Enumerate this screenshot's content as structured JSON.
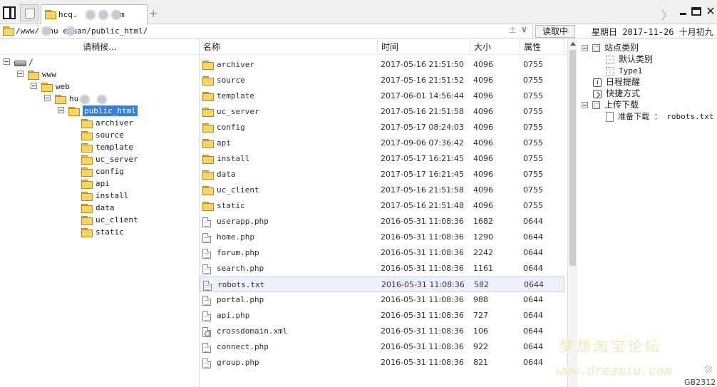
{
  "tabbar": {
    "active_tab_label": "hcq.",
    "active_tab_label_tail": "om",
    "new_tab_symbol": "+",
    "overflow_symbol": "〉"
  },
  "window": {
    "close_symbol": "✕"
  },
  "address": {
    "path": "/www/   /hu    equan/public_html/",
    "plusminus": "±",
    "dropdown": "∨",
    "read_button": "读取中",
    "date_text": "星期日  2017-11-26  十月初九"
  },
  "left_tree": {
    "header": "请稍候...",
    "root_label": "/",
    "www_label": "www",
    "web_label": "web",
    "site_label": "hu          a",
    "current_label": "public_html",
    "children": [
      "archiver",
      "source",
      "template",
      "uc_server",
      "config",
      "api",
      "install",
      "data",
      "uc_client",
      "static"
    ]
  },
  "file_list": {
    "columns": {
      "name": "名称",
      "time": "时间",
      "size": "大小",
      "perm": "属性"
    },
    "rows": [
      {
        "type": "folder",
        "name": "archiver",
        "time": "2017-05-16 21:51:50",
        "size": "4096",
        "perm": "0755"
      },
      {
        "type": "folder",
        "name": "source",
        "time": "2017-05-16 21:51:52",
        "size": "4096",
        "perm": "0755"
      },
      {
        "type": "folder",
        "name": "template",
        "time": "2017-06-01 14:56:44",
        "size": "4096",
        "perm": "0755"
      },
      {
        "type": "folder",
        "name": "uc_server",
        "time": "2017-05-16 21:51:58",
        "size": "4096",
        "perm": "0755"
      },
      {
        "type": "folder",
        "name": "config",
        "time": "2017-05-17 08:24:03",
        "size": "4096",
        "perm": "0755"
      },
      {
        "type": "folder",
        "name": "api",
        "time": "2017-09-06 07:36:42",
        "size": "4096",
        "perm": "0755"
      },
      {
        "type": "folder",
        "name": "install",
        "time": "2017-05-17 16:21:45",
        "size": "4096",
        "perm": "0755"
      },
      {
        "type": "folder",
        "name": "data",
        "time": "2017-05-17 16:21:45",
        "size": "4096",
        "perm": "0755"
      },
      {
        "type": "folder",
        "name": "uc_client",
        "time": "2017-05-16 21:51:58",
        "size": "4096",
        "perm": "0755"
      },
      {
        "type": "folder",
        "name": "static",
        "time": "2017-05-16 21:51:48",
        "size": "4096",
        "perm": "0755"
      },
      {
        "type": "file",
        "name": "userapp.php",
        "time": "2016-05-31 11:08:36",
        "size": "1682",
        "perm": "0644"
      },
      {
        "type": "file",
        "name": "home.php",
        "time": "2016-05-31 11:08:36",
        "size": "1290",
        "perm": "0644"
      },
      {
        "type": "file",
        "name": "forum.php",
        "time": "2016-05-31 11:08:36",
        "size": "2242",
        "perm": "0644"
      },
      {
        "type": "file",
        "name": "search.php",
        "time": "2016-05-31 11:08:36",
        "size": "1161",
        "perm": "0644"
      },
      {
        "type": "txt",
        "name": "robots.txt",
        "time": "2016-05-31 11:08:36",
        "size": "582",
        "perm": "0644",
        "selected": true
      },
      {
        "type": "file",
        "name": "portal.php",
        "time": "2016-05-31 11:08:36",
        "size": "988",
        "perm": "0644"
      },
      {
        "type": "file",
        "name": "api.php",
        "time": "2016-05-31 11:08:36",
        "size": "727",
        "perm": "0644"
      },
      {
        "type": "xml",
        "name": "crossdomain.xml",
        "time": "2016-05-31 11:08:36",
        "size": "106",
        "perm": "0644"
      },
      {
        "type": "file",
        "name": "connect.php",
        "time": "2016-05-31 11:08:36",
        "size": "922",
        "perm": "0644"
      },
      {
        "type": "file",
        "name": "group.php",
        "time": "2016-05-31 11:08:36",
        "size": "821",
        "perm": "0644"
      }
    ]
  },
  "right_tree": {
    "sites": "站点类别",
    "default_category": "默认类别",
    "type1": "Type1",
    "reminder": "日程提醒",
    "shortcut": "快捷方式",
    "transfers": "上传下载",
    "pending_download": "准备下载 ： robots.txt"
  },
  "footer": {
    "watermark_cn": "梦想淘宝论坛",
    "watermark_en": "www.dreamiu.com",
    "build": "GB2312"
  }
}
